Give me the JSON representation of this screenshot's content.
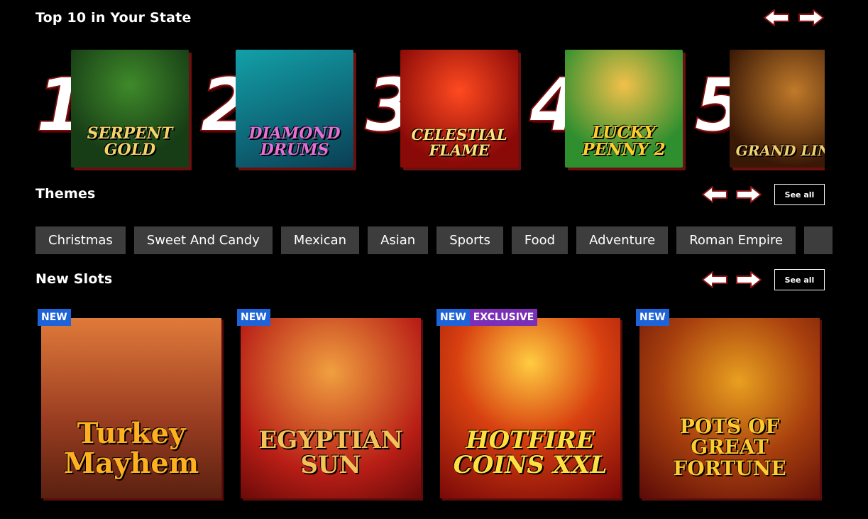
{
  "top10": {
    "title": "Top 10 in Your State",
    "items": [
      {
        "rank": "1",
        "title": "SERPENT GOLD",
        "bg": "#1f5a22",
        "fg": "#f5d36b"
      },
      {
        "rank": "2",
        "title": "DIAMOND DRUMS",
        "bg": "#0e6a73",
        "fg": "#e56fd8"
      },
      {
        "rank": "3",
        "title": "CELESTIAL FLAME",
        "bg": "#b5180f",
        "fg": "#ffe07a"
      },
      {
        "rank": "4",
        "title": "LUCKY PENNY 2",
        "bg": "#3da83b",
        "fg": "#ffce2e"
      },
      {
        "rank": "5",
        "title": "GRAND LINE",
        "bg": "#5a2a10",
        "fg": "#f0d070"
      }
    ]
  },
  "themes": {
    "title": "Themes",
    "see_all": "See all",
    "chips": [
      "Christmas",
      "Sweet And Candy",
      "Mexican",
      "Asian",
      "Sports",
      "Food",
      "Adventure",
      "Roman Empire",
      ""
    ]
  },
  "new_slots": {
    "title": "New Slots",
    "see_all": "See all",
    "items": [
      {
        "title": "Turkey Mayhem",
        "badges": [
          "NEW"
        ],
        "bg": "#9c4a2a",
        "fg": "#ffb020"
      },
      {
        "title": "EGYPTIAN SUN",
        "badges": [
          "NEW"
        ],
        "bg": "#b81e16",
        "fg": "#f5c25a"
      },
      {
        "title": "HOTFIRE COINS XXL",
        "badges": [
          "NEW",
          "EXCLUSIVE"
        ],
        "bg": "#a8120e",
        "fg": "#ffe040"
      },
      {
        "title": "POTS OF GREAT FORTUNE",
        "badges": [
          "NEW"
        ],
        "bg": "#8e1410",
        "fg": "#ffcc30"
      }
    ]
  },
  "colors": {
    "badge_new": "#1e63d8",
    "badge_exclusive": "#7b2fb6",
    "chip_bg": "#3d3d3d",
    "arrow_stroke": "#8a1515"
  }
}
